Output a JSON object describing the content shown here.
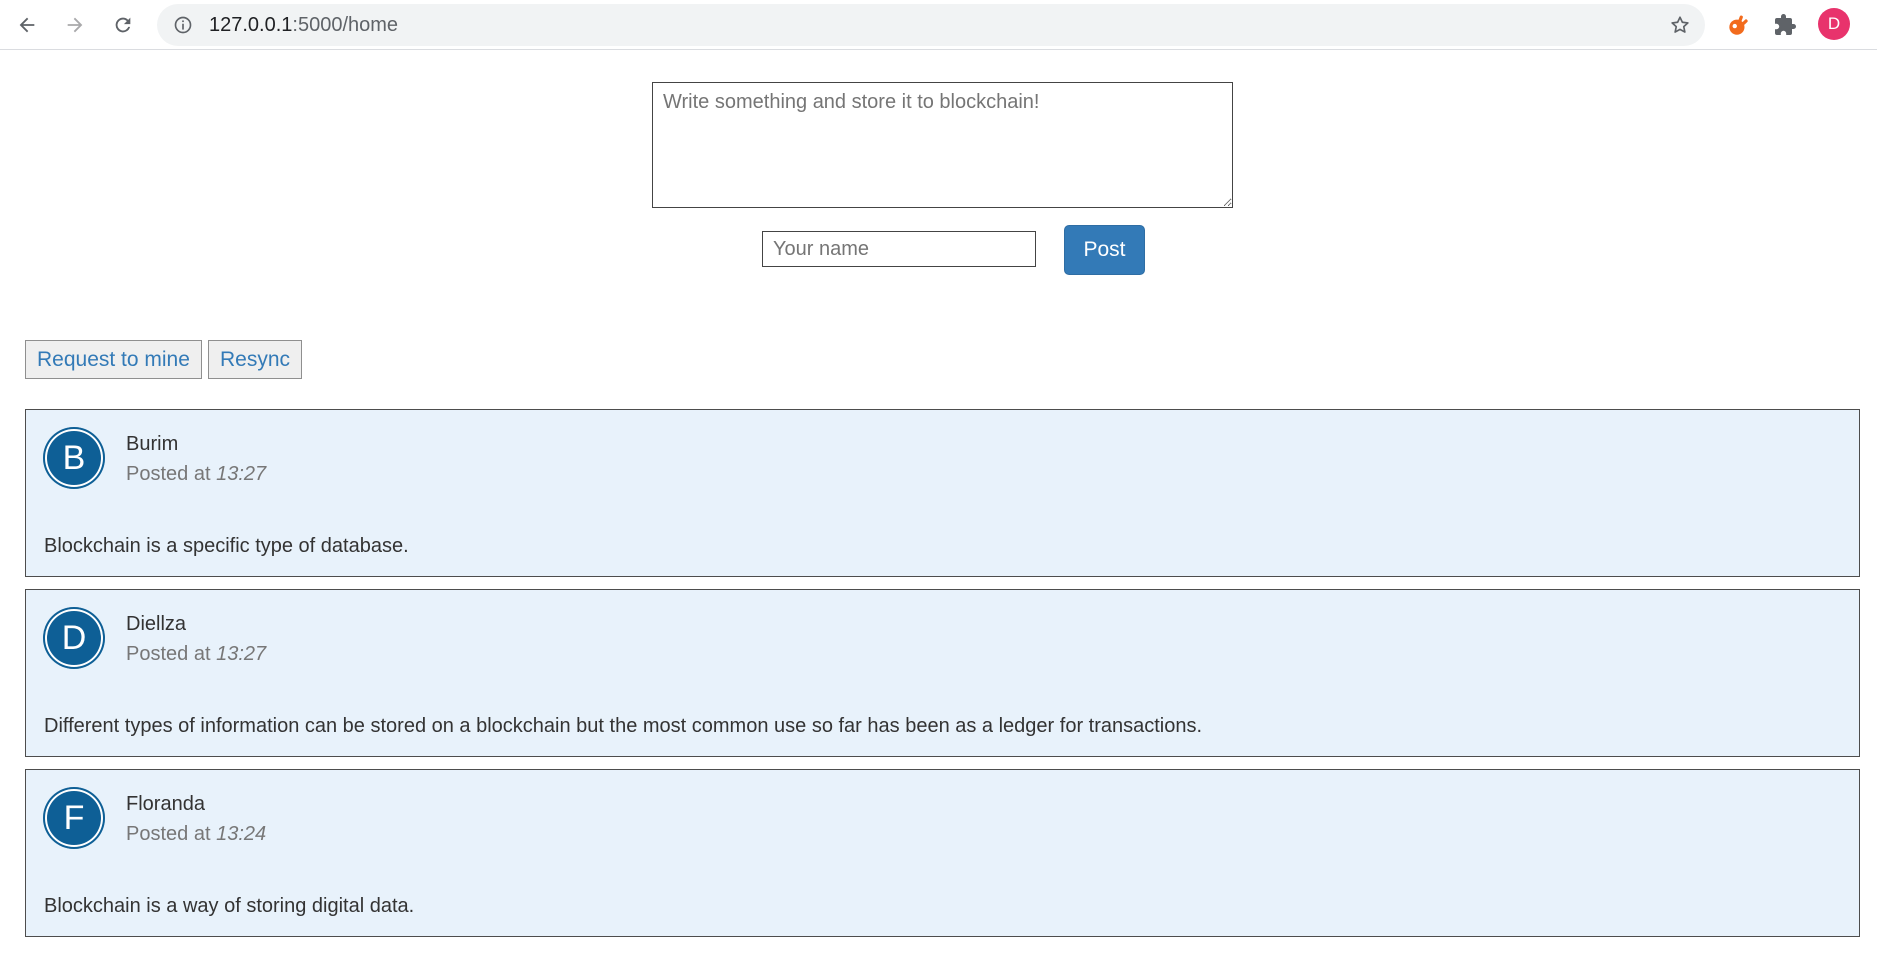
{
  "browser": {
    "url_host": "127.0.0.1",
    "url_rest": ":5000/home",
    "profile_initial": "D",
    "colors": {
      "profile": "#e8336c",
      "extension_orange": "#f26b1d"
    }
  },
  "form": {
    "textarea_placeholder": "Write something and store it to blockchain!",
    "name_placeholder": "Your name",
    "post_label": "Post"
  },
  "actions": {
    "mine_label": "Request to mine",
    "resync_label": "Resync"
  },
  "posts": [
    {
      "initial": "B",
      "author": "Burim",
      "posted_prefix": "Posted at",
      "time": "13:27",
      "content": "Blockchain is a specific type of database."
    },
    {
      "initial": "D",
      "author": "Diellza",
      "posted_prefix": "Posted at",
      "time": "13:27",
      "content": "Different types of information can be stored on a blockchain but the most common use so far has been as a ledger for transactions."
    },
    {
      "initial": "F",
      "author": "Floranda",
      "posted_prefix": "Posted at",
      "time": "13:24",
      "content": "Blockchain is a way of storing digital data."
    }
  ],
  "colors": {
    "post_bg": "#e8f2fb",
    "avatar_bg": "#0e5f96",
    "primary_button": "#337ab7",
    "link_text": "#337ab7"
  }
}
